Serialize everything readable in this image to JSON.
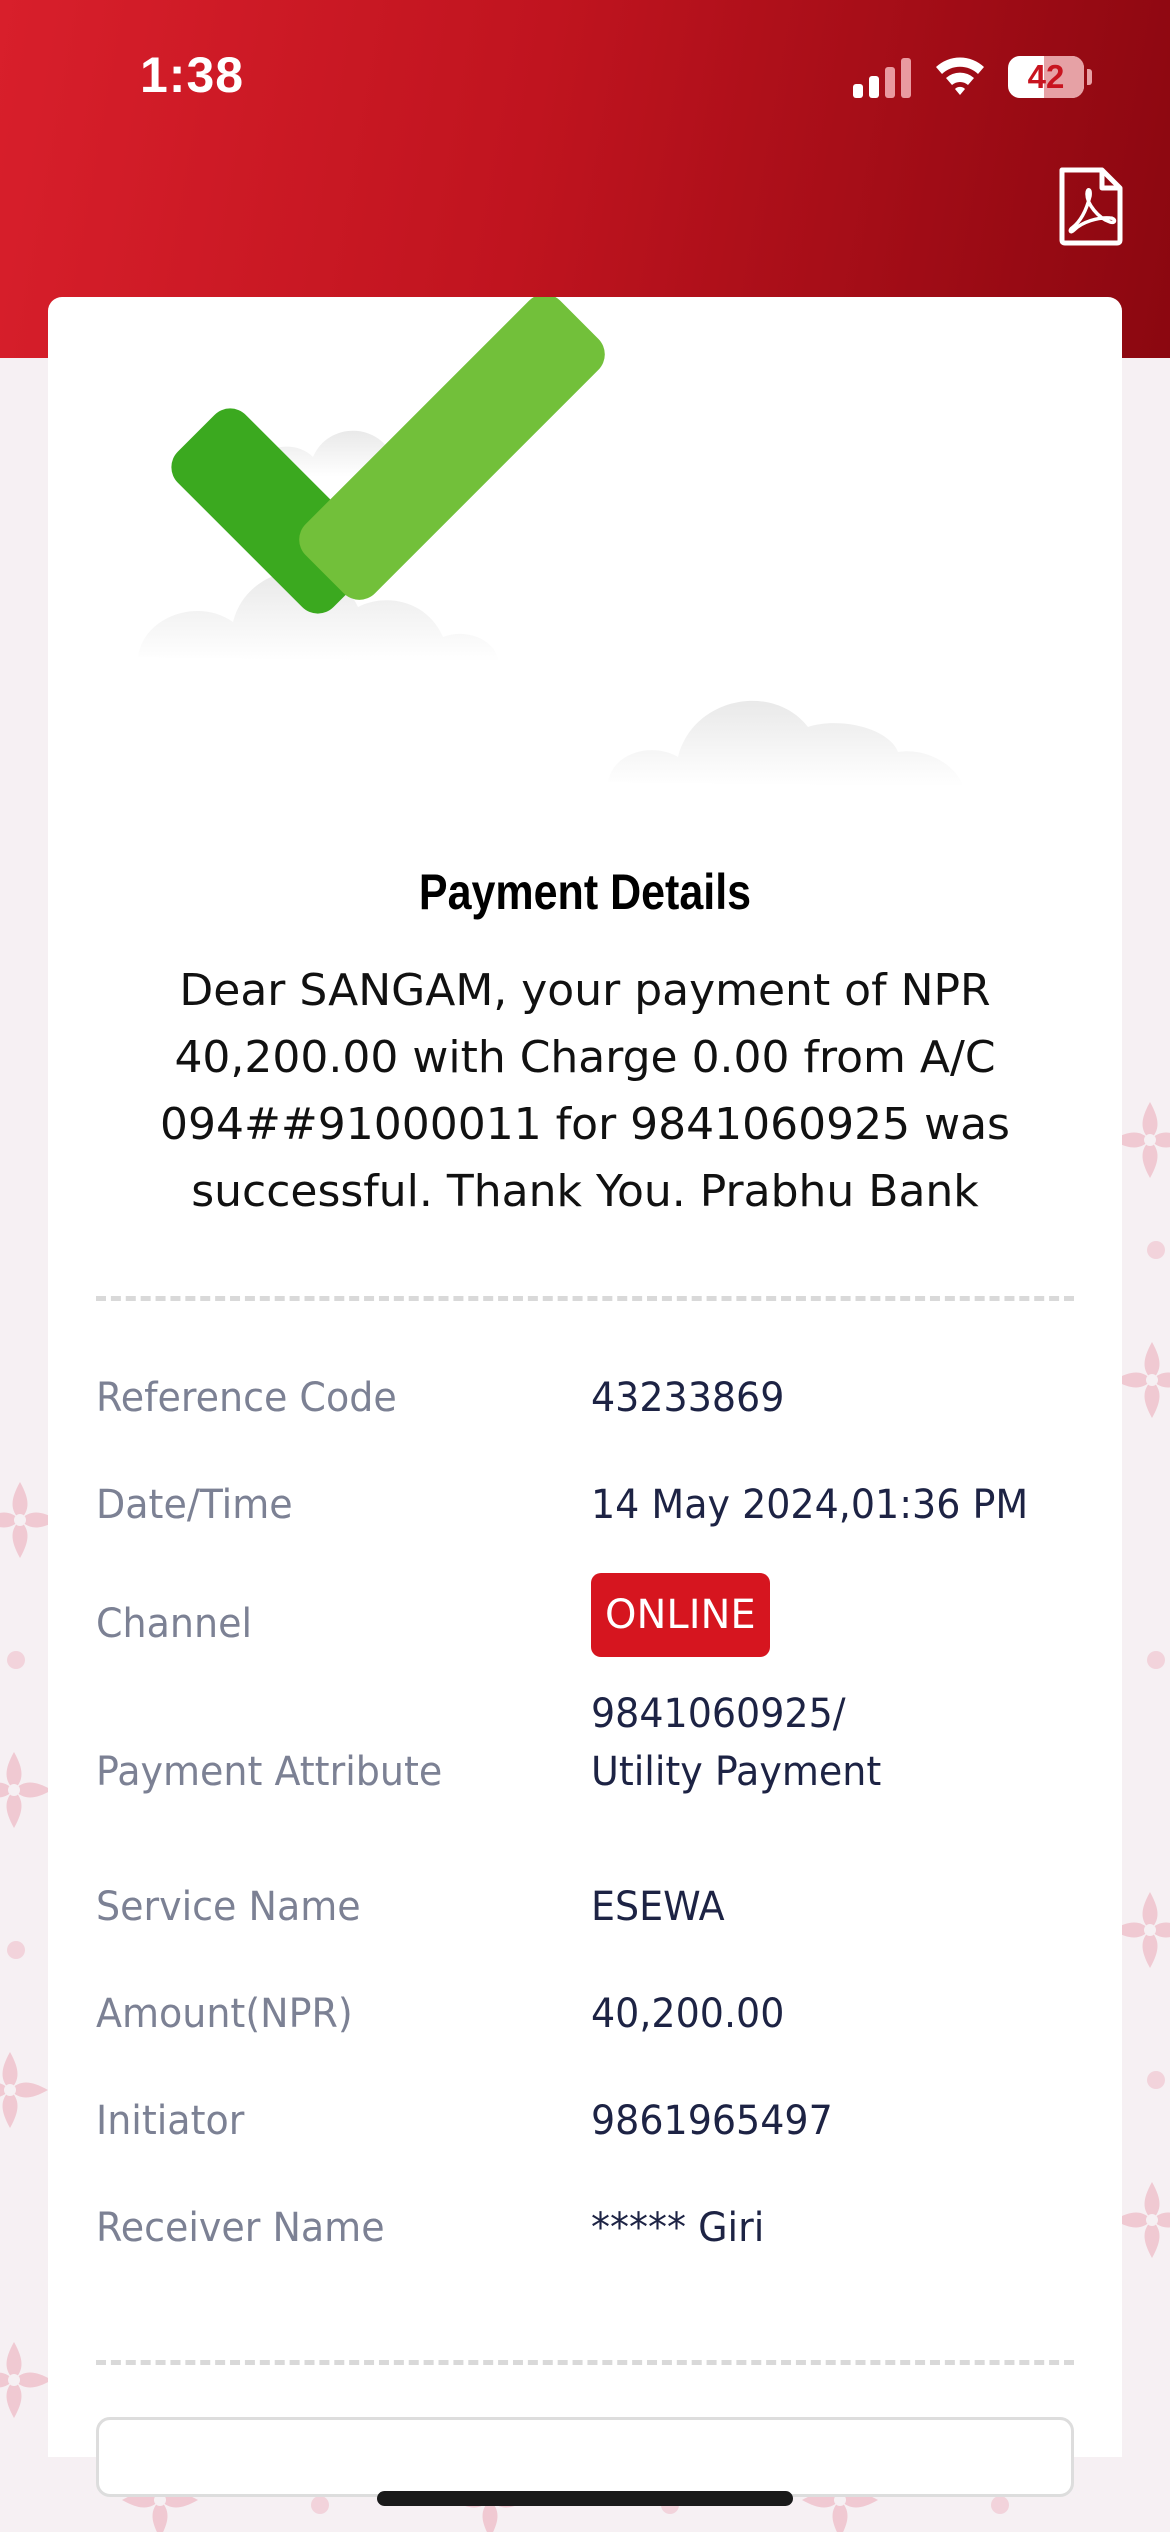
{
  "status_bar": {
    "time": "1:38",
    "battery": "42"
  },
  "header": {
    "pdf_icon": "pdf-icon"
  },
  "hero": {
    "icon": "checkmark-icon",
    "colors": {
      "check_light": "#72c03a",
      "check_dark": "#3ba91f"
    }
  },
  "card": {
    "title": "Payment Details",
    "message": "Dear SANGAM, your payment of NPR 40,200.00 with Charge 0.00 from A/C 094##91000011 for 9841060925 was successful. Thank You. Prabhu Bank"
  },
  "details": [
    {
      "label": "Reference Code",
      "value": "43233869"
    },
    {
      "label": "Date/Time",
      "value": "14 May 2024,01:36 PM"
    },
    {
      "label": "Channel",
      "value": "ONLINE"
    },
    {
      "label": "Payment Attribute",
      "value_line1": "9841060925/",
      "value_line2": "Utility Payment"
    },
    {
      "label": "Service Name",
      "value": "ESEWA"
    },
    {
      "label": "Amount(NPR)",
      "value": "40,200.00"
    },
    {
      "label": "Initiator",
      "value": "9861965497"
    },
    {
      "label": "Receiver Name",
      "value": "***** Giri"
    }
  ],
  "theme": {
    "brand_red": "#d6151f",
    "label_color": "#7c8194",
    "value_color": "#1d2344"
  }
}
